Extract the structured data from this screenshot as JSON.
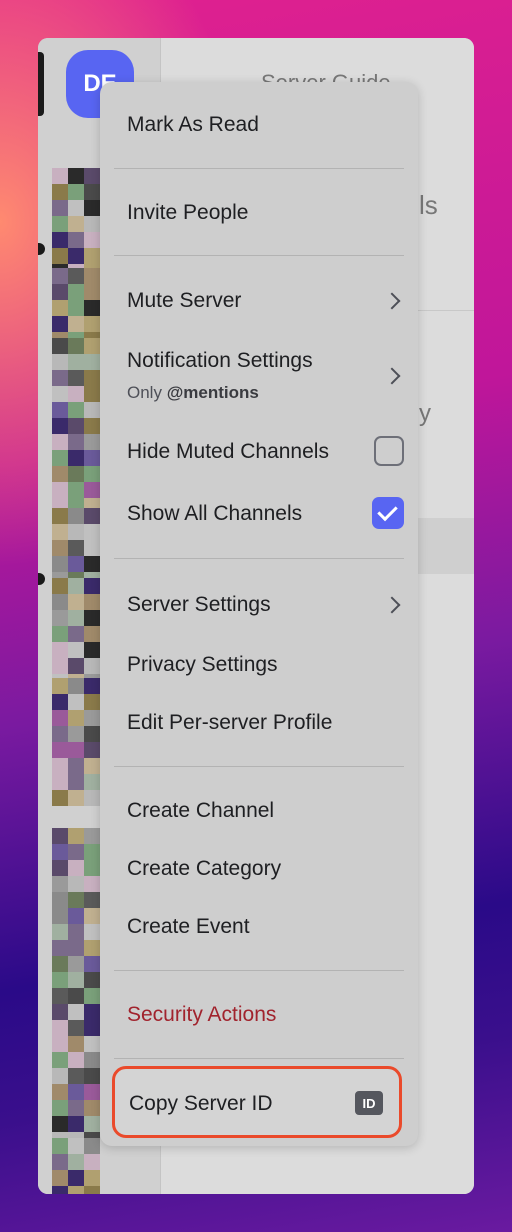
{
  "server": {
    "avatar_initials": "DE"
  },
  "background_text": {
    "header": "Server Guide",
    "channels_fragment": "ls",
    "row_fragment": "y"
  },
  "menu": {
    "mark_as_read": "Mark As Read",
    "invite_people": "Invite People",
    "mute_server": "Mute Server",
    "notification_settings": "Notification Settings",
    "notification_sub_prefix": "Only ",
    "notification_sub_value": "@mentions",
    "hide_muted_channels": "Hide Muted Channels",
    "hide_muted_checked": false,
    "show_all_channels": "Show All Channels",
    "show_all_checked": true,
    "server_settings": "Server Settings",
    "privacy_settings": "Privacy Settings",
    "edit_profile": "Edit Per-server Profile",
    "create_channel": "Create Channel",
    "create_category": "Create Category",
    "create_event": "Create Event",
    "security_actions": "Security Actions",
    "copy_server_id": "Copy Server ID",
    "id_badge": "ID"
  },
  "colors": {
    "accent": "#5865f2",
    "danger": "#a1232d",
    "highlight": "#ea4a2b"
  }
}
